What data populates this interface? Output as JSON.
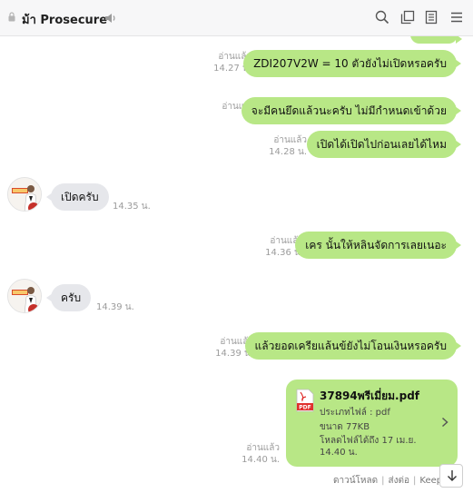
{
  "header": {
    "title": "ม้า Prosecure",
    "icons": [
      "lock-icon",
      "speaker-icon",
      "search-icon",
      "copy-icon",
      "notes-icon",
      "menu-icon"
    ]
  },
  "messages": [
    {
      "side": "out",
      "read": "อ่านแล้ว",
      "time": "14.27 น.",
      "text": "ZDI207V2W = 10 ตัวยังไม่เปิดหรอครับ"
    },
    {
      "side": "out",
      "read": "อ่านแล้ว",
      "time": "",
      "text": "จะมีคนยึดแล้วนะครับ ไม่มีกำหนดเข้าด้วย"
    },
    {
      "side": "out",
      "read": "อ่านแล้ว",
      "time": "14.28 น.",
      "text": "เปิดได้เปิดไปก่อนเลยได้ไหม"
    },
    {
      "side": "in",
      "time": "14.35 น.",
      "text": "เปิดครับ"
    },
    {
      "side": "out",
      "read": "อ่านแล้ว",
      "time": "14.36 น.",
      "text": "เคร นั้นให้หลินจัดการเลยเนอะ"
    },
    {
      "side": "in",
      "time": "14.39 น.",
      "text": "ครับ"
    },
    {
      "side": "out",
      "read": "อ่านแล้ว",
      "time": "14.39 น.",
      "text": "แล้วยอดเครียแล้นข้ยังไม่โอนเงินหรอครับ"
    }
  ],
  "file": {
    "read": "อ่านแล้ว",
    "time": "14.40 น.",
    "name": "37894พรีเมี่ยม.pdf",
    "type": "ประเภทไฟล์ : pdf",
    "size": "ขนาด 77KB",
    "expiry": "โหลดไฟล์ได้ถึง 17 เม.ย. 14.40 น."
  },
  "file_actions": {
    "download": "ดาวน์โหลด",
    "share": "ส่งต่อ",
    "keep": "Keep"
  },
  "colors": {
    "bubble_out": "#b8e786",
    "bubble_in": "#e6e7eb",
    "meta": "#9b9b9b"
  }
}
